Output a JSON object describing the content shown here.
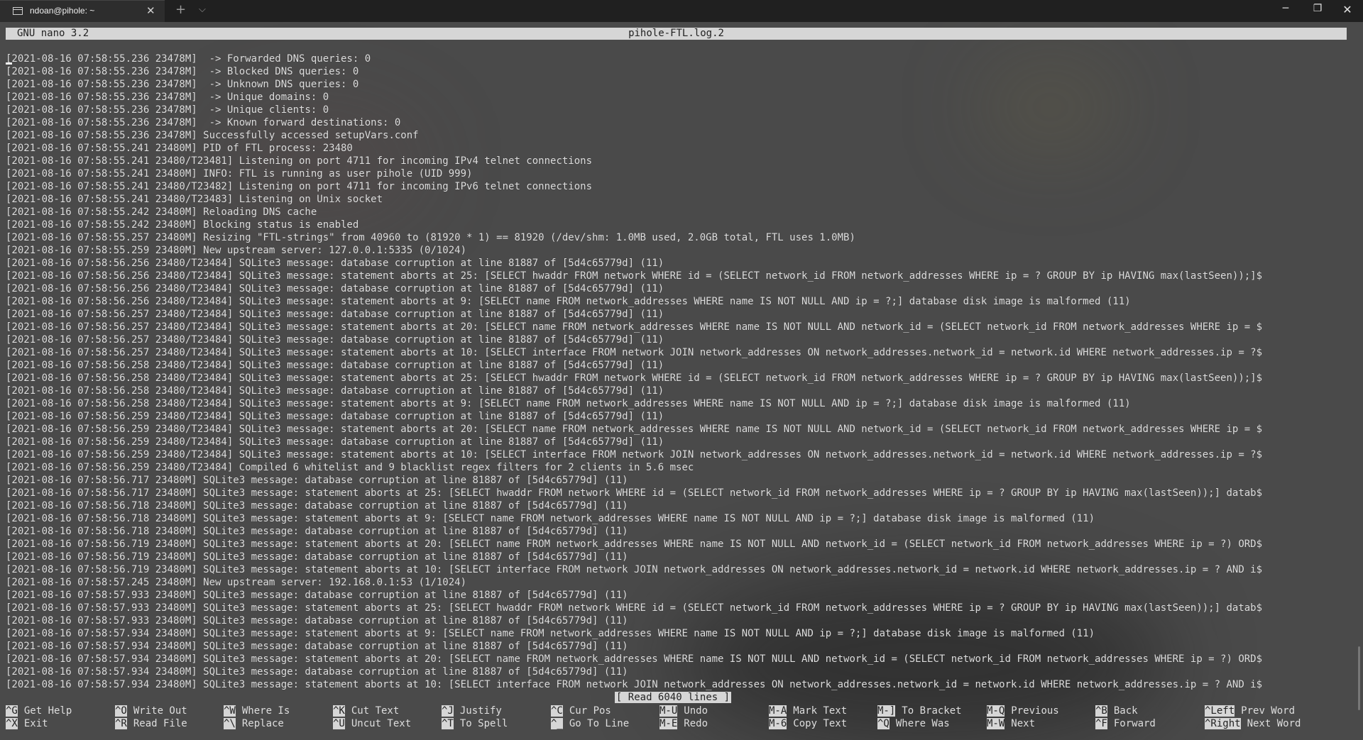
{
  "window": {
    "tab_title": "ndoan@pihole: ~",
    "tab_close": "✕",
    "new_tab": "+",
    "dropdown": "⌵",
    "minimize": "─",
    "maximize": "❐",
    "close": "✕"
  },
  "nano": {
    "version": "GNU nano 3.2",
    "filename": "pihole-FTL.log.2",
    "status_message": "[ Read 6040 lines ]"
  },
  "log_lines": [
    "[2021-08-16 07:58:55.236 23478M]  -> Forwarded DNS queries: 0",
    "[2021-08-16 07:58:55.236 23478M]  -> Blocked DNS queries: 0",
    "[2021-08-16 07:58:55.236 23478M]  -> Unknown DNS queries: 0",
    "[2021-08-16 07:58:55.236 23478M]  -> Unique domains: 0",
    "[2021-08-16 07:58:55.236 23478M]  -> Unique clients: 0",
    "[2021-08-16 07:58:55.236 23478M]  -> Known forward destinations: 0",
    "[2021-08-16 07:58:55.236 23478M] Successfully accessed setupVars.conf",
    "[2021-08-16 07:58:55.241 23480M] PID of FTL process: 23480",
    "[2021-08-16 07:58:55.241 23480/T23481] Listening on port 4711 for incoming IPv4 telnet connections",
    "[2021-08-16 07:58:55.241 23480M] INFO: FTL is running as user pihole (UID 999)",
    "[2021-08-16 07:58:55.241 23480/T23482] Listening on port 4711 for incoming IPv6 telnet connections",
    "[2021-08-16 07:58:55.241 23480/T23483] Listening on Unix socket",
    "[2021-08-16 07:58:55.242 23480M] Reloading DNS cache",
    "[2021-08-16 07:58:55.242 23480M] Blocking status is enabled",
    "[2021-08-16 07:58:55.257 23480M] Resizing \"FTL-strings\" from 40960 to (81920 * 1) == 81920 (/dev/shm: 1.0MB used, 2.0GB total, FTL uses 1.0MB)",
    "[2021-08-16 07:58:55.259 23480M] New upstream server: 127.0.0.1:5335 (0/1024)",
    "[2021-08-16 07:58:56.256 23480/T23484] SQLite3 message: database corruption at line 81887 of [5d4c65779d] (11)",
    "[2021-08-16 07:58:56.256 23480/T23484] SQLite3 message: statement aborts at 25: [SELECT hwaddr FROM network WHERE id = (SELECT network_id FROM network_addresses WHERE ip = ? GROUP BY ip HAVING max(lastSeen));]$",
    "[2021-08-16 07:58:56.256 23480/T23484] SQLite3 message: database corruption at line 81887 of [5d4c65779d] (11)",
    "[2021-08-16 07:58:56.256 23480/T23484] SQLite3 message: statement aborts at 9: [SELECT name FROM network_addresses WHERE name IS NOT NULL AND ip = ?;] database disk image is malformed (11)",
    "[2021-08-16 07:58:56.257 23480/T23484] SQLite3 message: database corruption at line 81887 of [5d4c65779d] (11)",
    "[2021-08-16 07:58:56.257 23480/T23484] SQLite3 message: statement aborts at 20: [SELECT name FROM network_addresses WHERE name IS NOT NULL AND network_id = (SELECT network_id FROM network_addresses WHERE ip = $",
    "[2021-08-16 07:58:56.257 23480/T23484] SQLite3 message: database corruption at line 81887 of [5d4c65779d] (11)",
    "[2021-08-16 07:58:56.257 23480/T23484] SQLite3 message: statement aborts at 10: [SELECT interface FROM network JOIN network_addresses ON network_addresses.network_id = network.id WHERE network_addresses.ip = ?$",
    "[2021-08-16 07:58:56.258 23480/T23484] SQLite3 message: database corruption at line 81887 of [5d4c65779d] (11)",
    "[2021-08-16 07:58:56.258 23480/T23484] SQLite3 message: statement aborts at 25: [SELECT hwaddr FROM network WHERE id = (SELECT network_id FROM network_addresses WHERE ip = ? GROUP BY ip HAVING max(lastSeen));]$",
    "[2021-08-16 07:58:56.258 23480/T23484] SQLite3 message: database corruption at line 81887 of [5d4c65779d] (11)",
    "[2021-08-16 07:58:56.258 23480/T23484] SQLite3 message: statement aborts at 9: [SELECT name FROM network_addresses WHERE name IS NOT NULL AND ip = ?;] database disk image is malformed (11)",
    "[2021-08-16 07:58:56.259 23480/T23484] SQLite3 message: database corruption at line 81887 of [5d4c65779d] (11)",
    "[2021-08-16 07:58:56.259 23480/T23484] SQLite3 message: statement aborts at 20: [SELECT name FROM network_addresses WHERE name IS NOT NULL AND network_id = (SELECT network_id FROM network_addresses WHERE ip = $",
    "[2021-08-16 07:58:56.259 23480/T23484] SQLite3 message: database corruption at line 81887 of [5d4c65779d] (11)",
    "[2021-08-16 07:58:56.259 23480/T23484] SQLite3 message: statement aborts at 10: [SELECT interface FROM network JOIN network_addresses ON network_addresses.network_id = network.id WHERE network_addresses.ip = ?$",
    "[2021-08-16 07:58:56.259 23480/T23484] Compiled 6 whitelist and 9 blacklist regex filters for 2 clients in 5.6 msec",
    "[2021-08-16 07:58:56.717 23480M] SQLite3 message: database corruption at line 81887 of [5d4c65779d] (11)",
    "[2021-08-16 07:58:56.717 23480M] SQLite3 message: statement aborts at 25: [SELECT hwaddr FROM network WHERE id = (SELECT network_id FROM network_addresses WHERE ip = ? GROUP BY ip HAVING max(lastSeen));] datab$",
    "[2021-08-16 07:58:56.718 23480M] SQLite3 message: database corruption at line 81887 of [5d4c65779d] (11)",
    "[2021-08-16 07:58:56.718 23480M] SQLite3 message: statement aborts at 9: [SELECT name FROM network_addresses WHERE name IS NOT NULL AND ip = ?;] database disk image is malformed (11)",
    "[2021-08-16 07:58:56.718 23480M] SQLite3 message: database corruption at line 81887 of [5d4c65779d] (11)",
    "[2021-08-16 07:58:56.719 23480M] SQLite3 message: statement aborts at 20: [SELECT name FROM network_addresses WHERE name IS NOT NULL AND network_id = (SELECT network_id FROM network_addresses WHERE ip = ?) ORD$",
    "[2021-08-16 07:58:56.719 23480M] SQLite3 message: database corruption at line 81887 of [5d4c65779d] (11)",
    "[2021-08-16 07:58:56.719 23480M] SQLite3 message: statement aborts at 10: [SELECT interface FROM network JOIN network_addresses ON network_addresses.network_id = network.id WHERE network_addresses.ip = ? AND i$",
    "[2021-08-16 07:58:57.245 23480M] New upstream server: 192.168.0.1:53 (1/1024)",
    "[2021-08-16 07:58:57.933 23480M] SQLite3 message: database corruption at line 81887 of [5d4c65779d] (11)",
    "[2021-08-16 07:58:57.933 23480M] SQLite3 message: statement aborts at 25: [SELECT hwaddr FROM network WHERE id = (SELECT network_id FROM network_addresses WHERE ip = ? GROUP BY ip HAVING max(lastSeen));] datab$",
    "[2021-08-16 07:58:57.933 23480M] SQLite3 message: database corruption at line 81887 of [5d4c65779d] (11)",
    "[2021-08-16 07:58:57.934 23480M] SQLite3 message: statement aborts at 9: [SELECT name FROM network_addresses WHERE name IS NOT NULL AND ip = ?;] database disk image is malformed (11)",
    "[2021-08-16 07:58:57.934 23480M] SQLite3 message: database corruption at line 81887 of [5d4c65779d] (11)",
    "[2021-08-16 07:58:57.934 23480M] SQLite3 message: statement aborts at 20: [SELECT name FROM network_addresses WHERE name IS NOT NULL AND network_id = (SELECT network_id FROM network_addresses WHERE ip = ?) ORD$",
    "[2021-08-16 07:58:57.934 23480M] SQLite3 message: database corruption at line 81887 of [5d4c65779d] (11)",
    "[2021-08-16 07:58:57.934 23480M] SQLite3 message: statement aborts at 10: [SELECT interface FROM network JOIN network_addresses ON network_addresses.network_id = network.id WHERE network_addresses.ip = ? AND i$"
  ],
  "shortcuts": [
    {
      "key": "^G",
      "label": "Get Help"
    },
    {
      "key": "^X",
      "label": "Exit"
    },
    {
      "key": "^O",
      "label": "Write Out"
    },
    {
      "key": "^R",
      "label": "Read File"
    },
    {
      "key": "^W",
      "label": "Where Is"
    },
    {
      "key": "^\\",
      "label": "Replace"
    },
    {
      "key": "^K",
      "label": "Cut Text"
    },
    {
      "key": "^U",
      "label": "Uncut Text"
    },
    {
      "key": "^J",
      "label": "Justify"
    },
    {
      "key": "^T",
      "label": "To Spell"
    },
    {
      "key": "^C",
      "label": "Cur Pos"
    },
    {
      "key": "^_",
      "label": "Go To Line"
    },
    {
      "key": "M-U",
      "label": "Undo"
    },
    {
      "key": "M-E",
      "label": "Redo"
    },
    {
      "key": "M-A",
      "label": "Mark Text"
    },
    {
      "key": "M-6",
      "label": "Copy Text"
    },
    {
      "key": "M-]",
      "label": "To Bracket"
    },
    {
      "key": "^Q",
      "label": "Where Was"
    },
    {
      "key": "M-Q",
      "label": "Previous"
    },
    {
      "key": "M-W",
      "label": "Next"
    },
    {
      "key": "^B",
      "label": "Back"
    },
    {
      "key": "^F",
      "label": "Forward"
    },
    {
      "key": "^Left",
      "label": "Prev Word"
    },
    {
      "key": "^Right",
      "label": "Next Word"
    }
  ]
}
